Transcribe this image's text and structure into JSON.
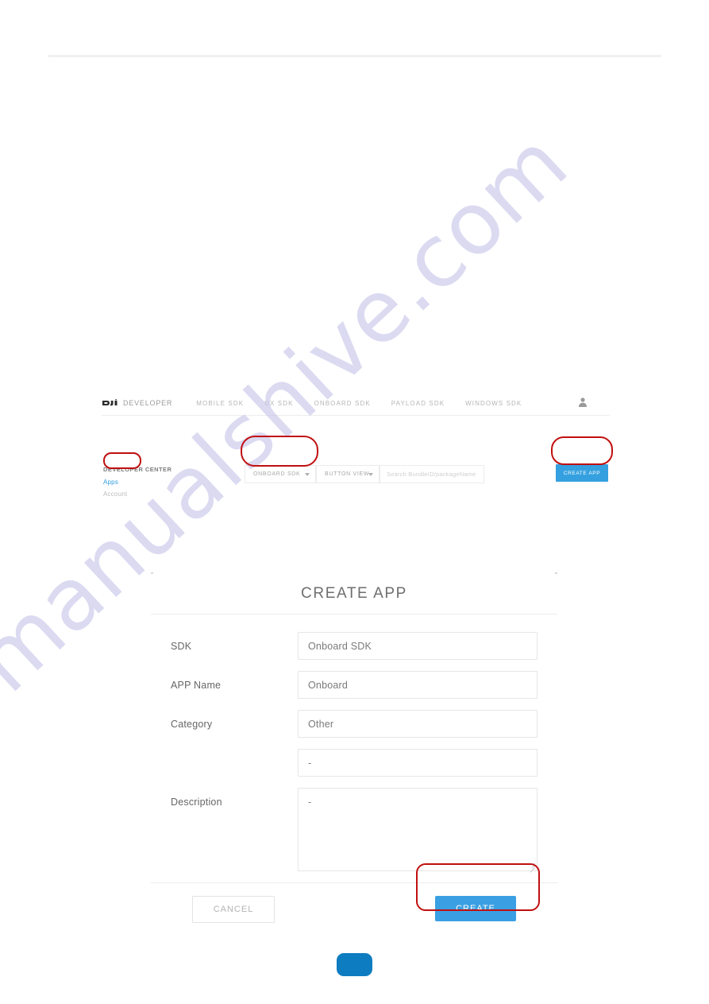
{
  "page": {
    "watermark": "manualshive.com",
    "watermark_color": "#c6c4ea",
    "accent_color": "#34a0e0",
    "highlight_color": "#c10f0f"
  },
  "navbar": {
    "brand": "DEVELOPER",
    "brand_logo": "dji-logo",
    "links": [
      {
        "label": "MOBILE SDK"
      },
      {
        "label": "UX SDK"
      },
      {
        "label": "ONBOARD SDK"
      },
      {
        "label": "PAYLOAD SDK"
      },
      {
        "label": "WINDOWS SDK"
      }
    ],
    "user_icon": "user-icon"
  },
  "sidebar": {
    "title": "DEVELOPER CENTER",
    "items": [
      {
        "label": "Apps",
        "active": true
      },
      {
        "label": "Account",
        "active": false
      }
    ]
  },
  "toolbar": {
    "sdk_filter": {
      "value": "ONBOARD SDK",
      "icon": "chevron-down-icon"
    },
    "view_filter": {
      "value": "BUTTON VIEW",
      "icon": "chevron-down-icon"
    },
    "search": {
      "placeholder": "Search BundleID/packageName",
      "value": ""
    },
    "create_app_label": "CREATE APP"
  },
  "dialog": {
    "title": "CREATE APP",
    "fields": [
      {
        "label": "SDK",
        "type": "select",
        "value": "Onboard SDK",
        "icon": "chevron-down-icon"
      },
      {
        "label": "APP Name",
        "type": "text",
        "value": "Onboard"
      },
      {
        "label": "Category",
        "type": "select",
        "value": "Other",
        "icon": "chevron-down-icon"
      },
      {
        "label": "",
        "type": "text",
        "value": "-"
      },
      {
        "label": "Description",
        "type": "textarea",
        "value": "-"
      }
    ],
    "cancel_label": "CANCEL",
    "create_label": "CREATE"
  },
  "annotations": [
    {
      "target": "sidebar-item-apps"
    },
    {
      "target": "sdk-filter-select"
    },
    {
      "target": "create-app-button"
    },
    {
      "target": "dialog-create-button"
    }
  ]
}
